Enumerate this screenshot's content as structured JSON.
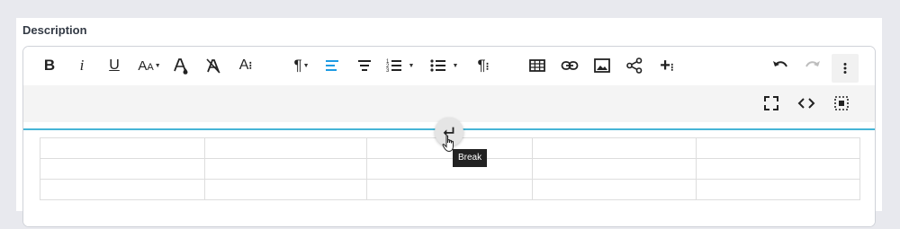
{
  "field": {
    "label": "Description"
  },
  "toolbar": {
    "buttons": [
      {
        "icon": "bold-icon"
      },
      {
        "icon": "italic-icon"
      },
      {
        "icon": "underline-icon"
      },
      {
        "icon": "font-size-icon"
      },
      {
        "icon": "text-color-icon"
      },
      {
        "icon": "clear-formatting-icon"
      },
      {
        "icon": "more-text-icon"
      },
      {
        "icon": "paragraph-format-icon"
      },
      {
        "icon": "align-left-icon"
      },
      {
        "icon": "align-center-icon"
      },
      {
        "icon": "ordered-list-icon"
      },
      {
        "icon": "unordered-list-icon"
      },
      {
        "icon": "more-paragraph-icon"
      },
      {
        "icon": "insert-table-icon"
      },
      {
        "icon": "insert-link-icon"
      },
      {
        "icon": "insert-image-icon"
      },
      {
        "icon": "share-icon"
      },
      {
        "icon": "more-insert-icon"
      },
      {
        "icon": "undo-icon"
      },
      {
        "icon": "redo-icon"
      },
      {
        "icon": "more-options-icon"
      }
    ],
    "secondary": [
      {
        "icon": "fullscreen-icon"
      },
      {
        "icon": "code-view-icon"
      },
      {
        "icon": "select-all-icon"
      }
    ],
    "accent_color": "#1e9be3"
  },
  "table": {
    "rows": 3,
    "columns": 5
  },
  "tooltip": {
    "text": "Break"
  }
}
